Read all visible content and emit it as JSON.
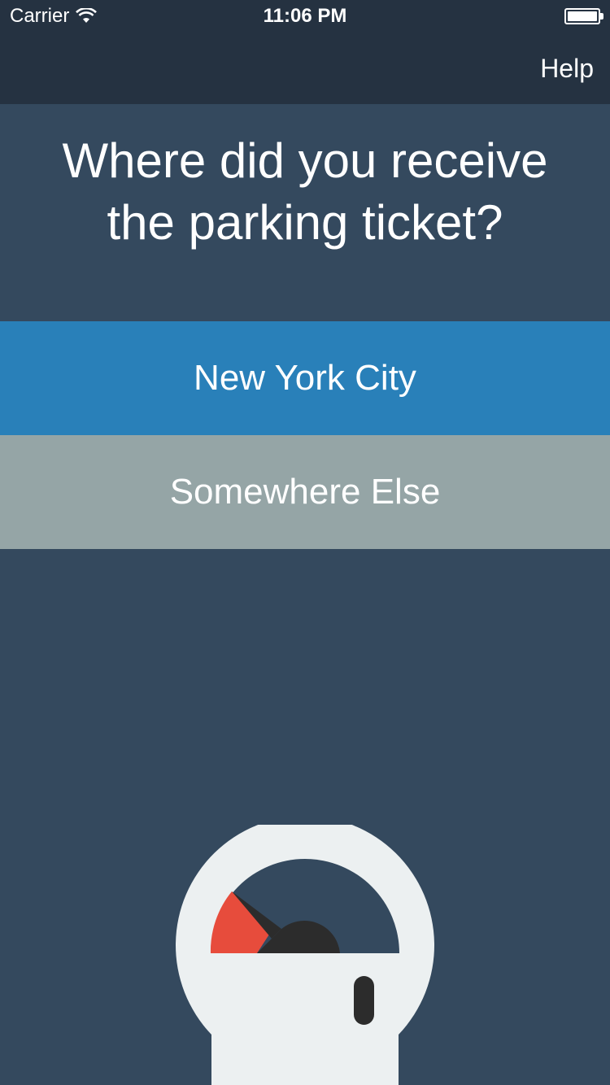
{
  "status_bar": {
    "carrier": "Carrier",
    "time": "11:06 PM",
    "wifi_icon": "wifi-icon",
    "battery_icon": "battery-icon"
  },
  "nav": {
    "help_label": "Help"
  },
  "question": {
    "line1": "Where did you receive",
    "line2": "the parking ticket?"
  },
  "options": [
    {
      "label": "New York City",
      "color": "#2980b9"
    },
    {
      "label": "Somewhere Else",
      "color": "#95a5a6"
    }
  ],
  "illustration": {
    "icon": "parking-meter-icon",
    "colors": {
      "body": "#ecf0f1",
      "dial": "#34495e",
      "expired": "#e74c3c",
      "needle": "#2c2c2c"
    }
  },
  "theme": {
    "background": "#34495e",
    "nav_background": "#253241",
    "text": "#ffffff"
  }
}
